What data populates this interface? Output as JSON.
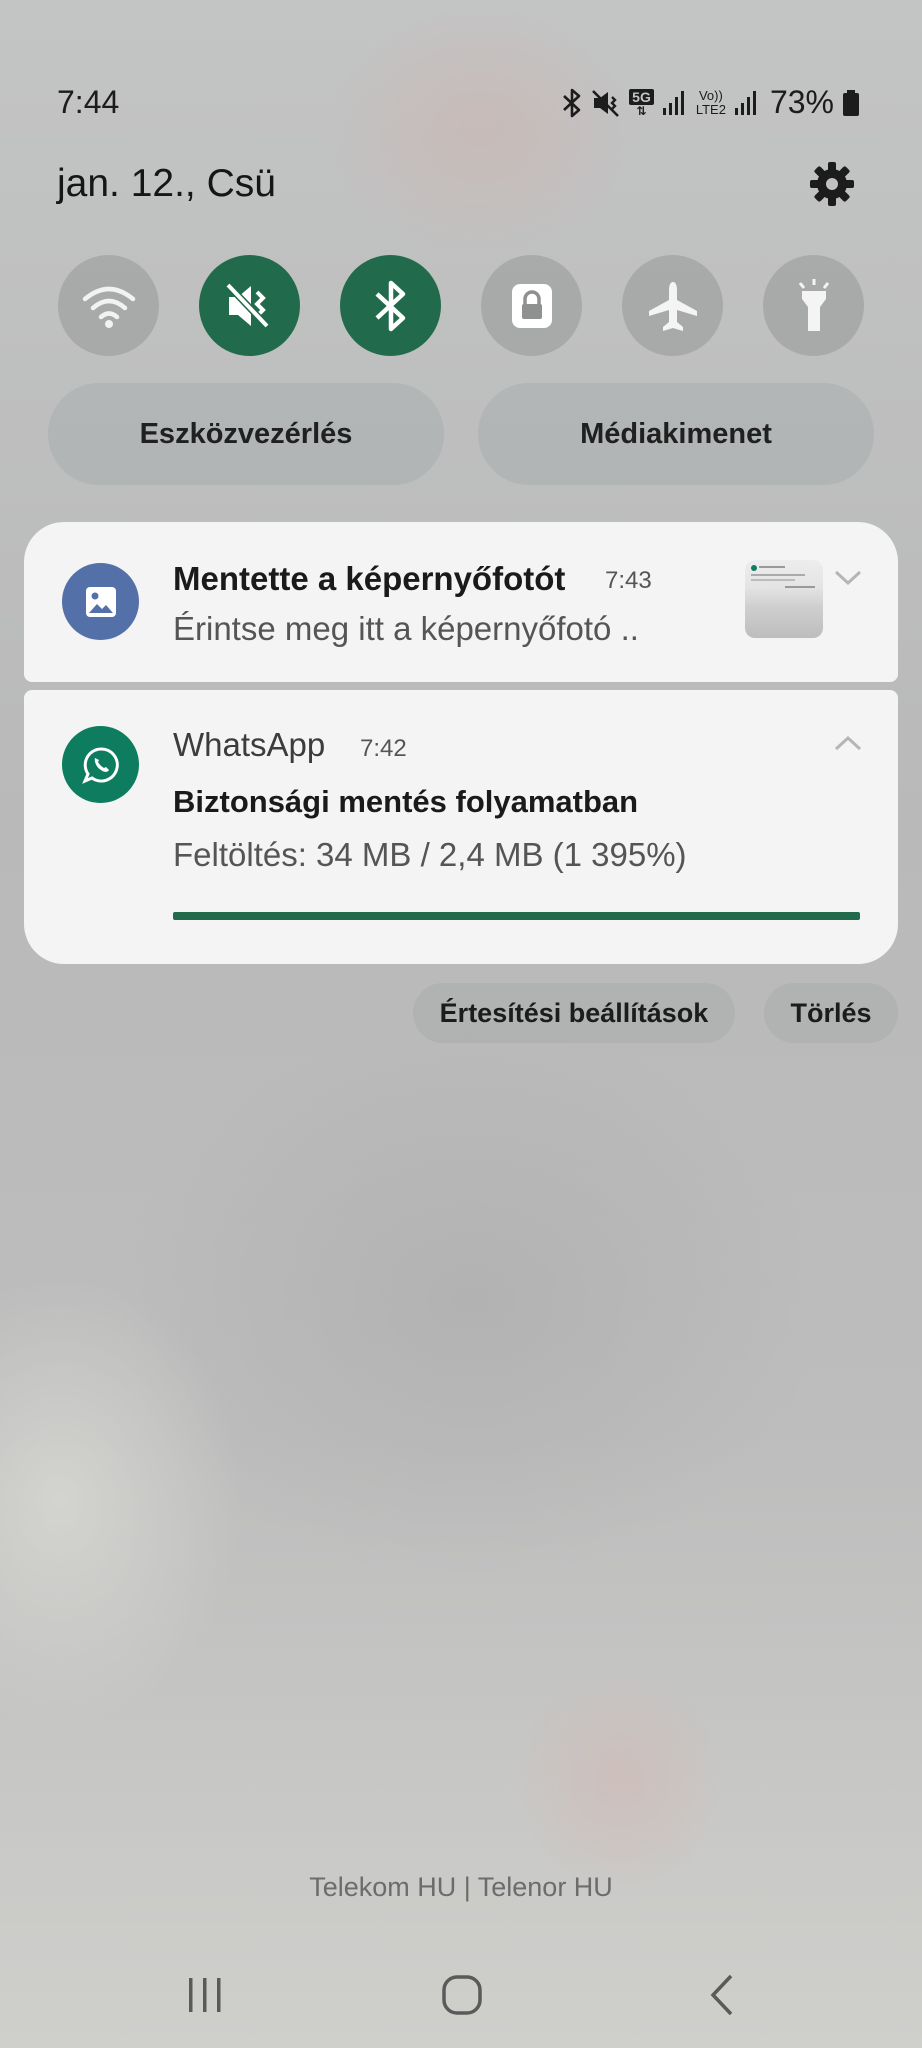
{
  "status_bar": {
    "time": "7:44",
    "network_5g": "5G",
    "volte_top": "Vo))",
    "volte_bottom": "LTE2",
    "battery": "73%",
    "icons": [
      "bluetooth-icon",
      "mute-icon",
      "5g-icon",
      "signal-icon",
      "volte-icon",
      "signal-icon",
      "battery-icon"
    ]
  },
  "header": {
    "date": "jan. 12., Csü",
    "settings_icon": "gear-icon"
  },
  "quick_settings": [
    {
      "name": "wifi",
      "icon": "wifi-icon",
      "active": false
    },
    {
      "name": "mute",
      "icon": "mute-icon",
      "active": true
    },
    {
      "name": "bluetooth",
      "icon": "bluetooth-icon",
      "active": true
    },
    {
      "name": "rotation-lock",
      "icon": "lock-icon",
      "active": false
    },
    {
      "name": "airplane",
      "icon": "airplane-icon",
      "active": false
    },
    {
      "name": "flashlight",
      "icon": "flashlight-icon",
      "active": false
    }
  ],
  "pills": {
    "device_control": "Eszközvezérlés",
    "media_output": "Médiakimenet"
  },
  "notifications": {
    "screenshot": {
      "title": "Mentette a képernyőfotót",
      "time": "7:43",
      "text": "Érintse meg itt a képernyőfotó ..",
      "icon": "image-icon",
      "icon_color": "#5470a8"
    },
    "whatsapp": {
      "app": "WhatsApp",
      "time": "7:42",
      "title": "Biztonsági mentés folyamatban",
      "text": "Feltöltés: 34 MB / 2,4 MB (1 395%)",
      "icon": "whatsapp-icon",
      "icon_color": "#0d7c5f",
      "progress": 1.0
    }
  },
  "actions": {
    "notification_settings": "Értesítési beállítások",
    "clear": "Törlés"
  },
  "carrier": "Telekom HU | Telenor HU",
  "nav": [
    "recents-icon",
    "home-icon",
    "back-icon"
  ],
  "colors": {
    "accent_green": "#216a4c"
  }
}
